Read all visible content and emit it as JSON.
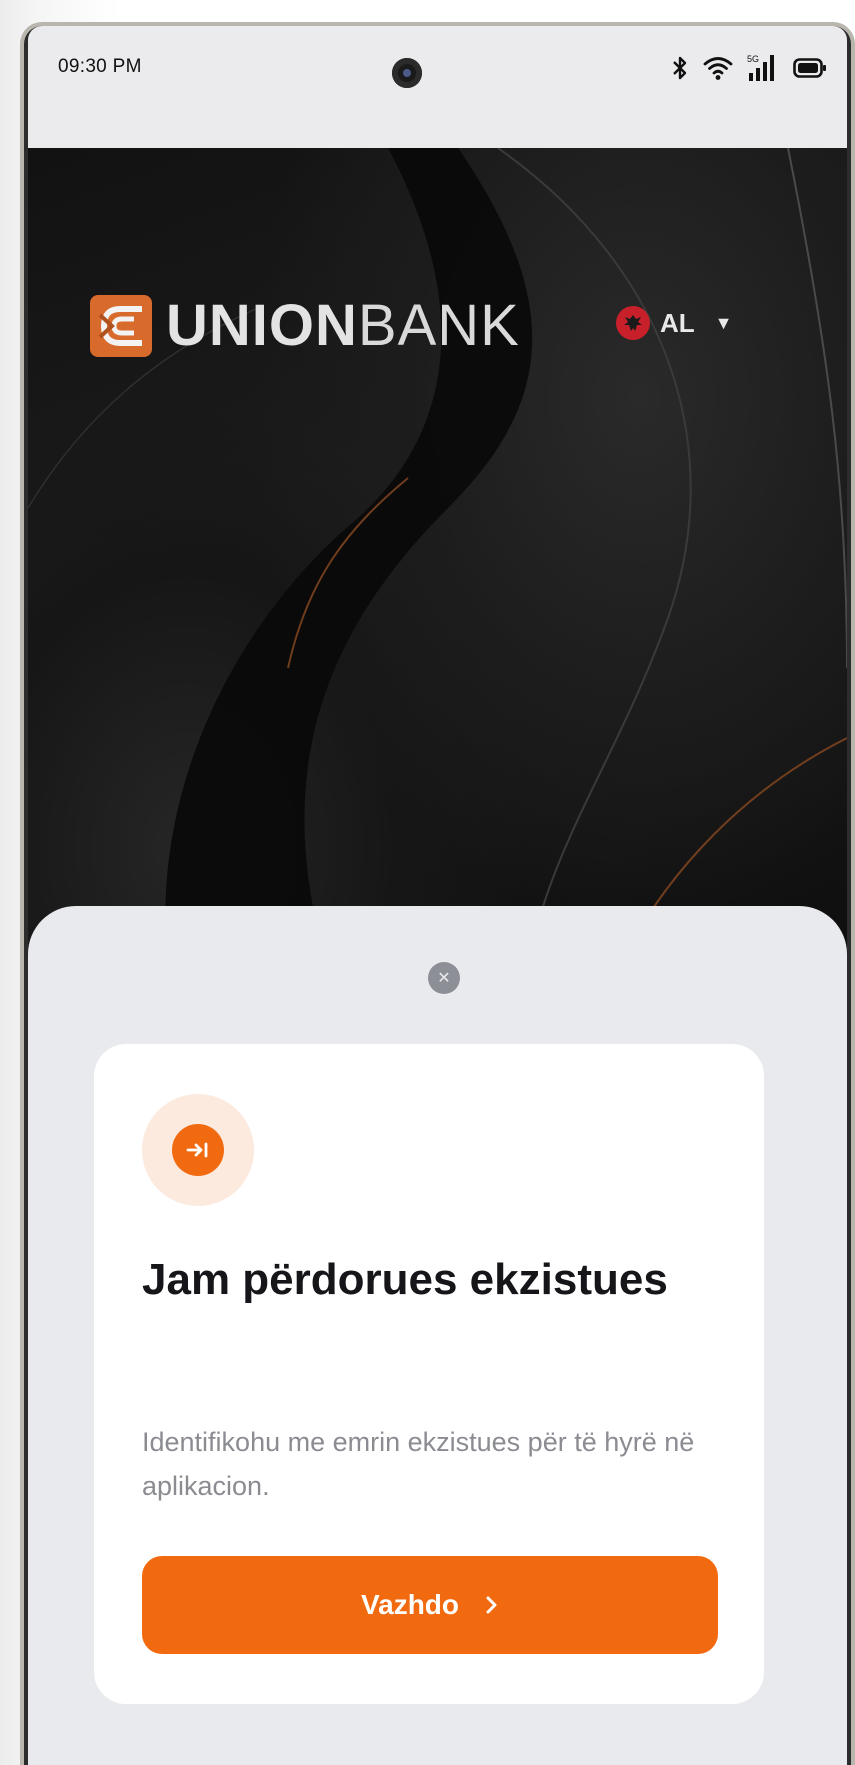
{
  "status_bar": {
    "time": "09:30 PM",
    "network_label": "5G",
    "icons": [
      "bluetooth-icon",
      "wifi-icon",
      "signal-icon",
      "battery-icon"
    ]
  },
  "header": {
    "brand_bold": "UNION",
    "brand_light": "BANK",
    "language_code": "AL",
    "flag_icon": "albania-flag-icon"
  },
  "sheet": {
    "card": {
      "title": "Jam përdorues ekzistues",
      "description": "Identifikohu me emrin ekzistues për të hyrë në aplikacion.",
      "button_label": "Vazhdo",
      "button_icon": "chevron-right-icon",
      "icon": "login-arrow-icon"
    }
  },
  "colors": {
    "accent": "#f26a0f",
    "logo": "#d86a2c",
    "sheet_bg": "#e9eaee",
    "hero_bg": "#141414"
  }
}
